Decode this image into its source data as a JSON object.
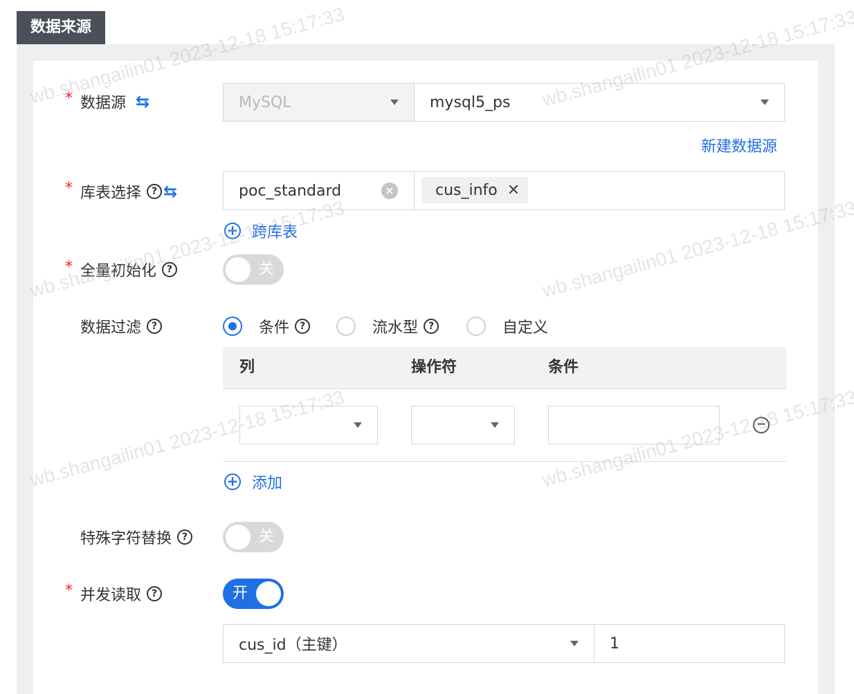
{
  "section": {
    "title": "数据来源"
  },
  "datasource": {
    "label": "数据源",
    "type_value": "MySQL",
    "name_value": "mysql5_ps",
    "new_link": "新建数据源"
  },
  "table_select": {
    "label": "库表选择",
    "db_value": "poc_standard",
    "table_tag": "cus_info",
    "cross_link": "跨库表"
  },
  "full_init": {
    "label": "全量初始化",
    "toggle_text": "关"
  },
  "data_filter": {
    "label": "数据过滤",
    "options": [
      {
        "label": "条件",
        "checked": true
      },
      {
        "label": "流水型",
        "checked": false
      },
      {
        "label": "自定义",
        "checked": false
      }
    ],
    "columns": [
      "列",
      "操作符",
      "条件"
    ],
    "add_link": "添加"
  },
  "special_char": {
    "label": "特殊字符替换",
    "toggle_text": "关"
  },
  "concurrent_read": {
    "label": "并发读取",
    "toggle_text": "开",
    "key_value": "cus_id（主键）",
    "count_value": "1"
  },
  "watermark": {
    "user": "wb.shangailin01",
    "time": "2023-12-18 15:17:33"
  },
  "colors": {
    "accent": "#1f6fe5",
    "required": "#f5222d",
    "tab_bg": "#4b4f59"
  }
}
